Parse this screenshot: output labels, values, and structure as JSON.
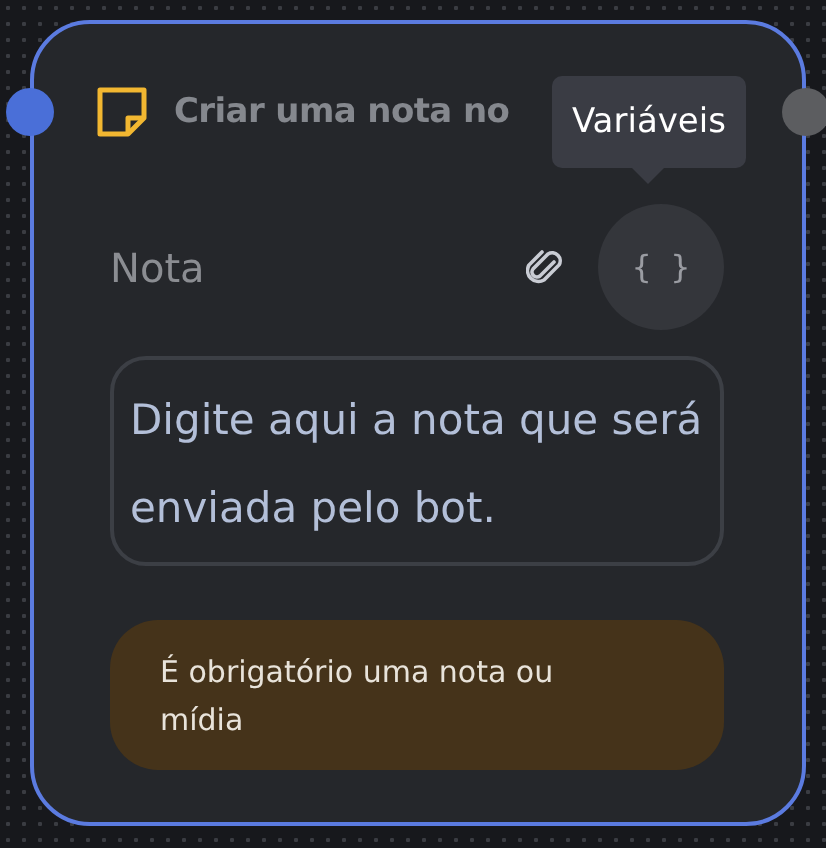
{
  "node": {
    "selected": true,
    "title": "Criar uma nota no",
    "tooltip": "Variáveis",
    "label": "Nota",
    "variables_button": "{ }",
    "note_field": {
      "placeholder": "Digite aqui a nota que será enviada pelo bot."
    },
    "warning": "É obrigatório uma nota ou mídia"
  }
}
